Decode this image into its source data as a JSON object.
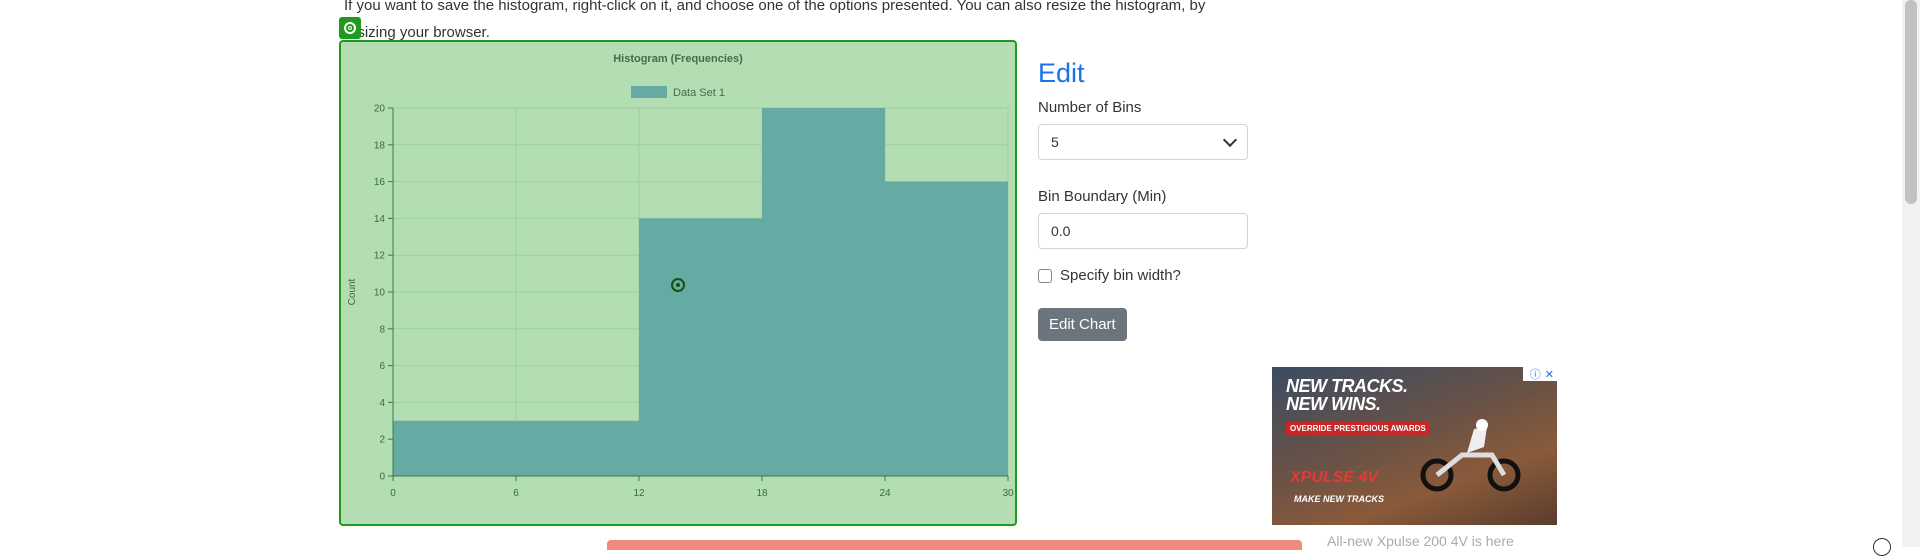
{
  "intro": {
    "line1": "If you want to save the histogram, right-click on it, and choose one of the options presented. You can also resize the histogram, by",
    "line2": "resizing your browser."
  },
  "chart_data": {
    "type": "bar",
    "title": "Histogram (Frequencies)",
    "xlabel": "",
    "ylabel": "Count",
    "bin_edges": [
      0,
      6,
      12,
      18,
      24,
      30
    ],
    "x_ticks": [
      "0",
      "6",
      "12",
      "18",
      "24",
      "30"
    ],
    "y_ticks": [
      "0",
      "2",
      "4",
      "6",
      "8",
      "10",
      "12",
      "14",
      "16",
      "18",
      "20"
    ],
    "series": [
      {
        "name": "Data Set 1",
        "values": [
          3,
          3,
          14,
          20,
          16
        ]
      }
    ],
    "xlim": [
      0,
      30
    ],
    "ylim": [
      0,
      20
    ],
    "legend": "top",
    "grid": true,
    "colors": {
      "bar": "#66aaa4",
      "background": "#b3ddb3",
      "grid": "#9fcf9f",
      "axis": "#3d7a3d"
    }
  },
  "edit": {
    "title": "Edit",
    "bins_label": "Number of Bins",
    "bins_value": "5",
    "boundary_label": "Bin Boundary (Min)",
    "boundary_value": "0.0",
    "bin_width_label": "Specify bin width?",
    "edit_button": "Edit Chart"
  },
  "ad": {
    "headline1": "NEW TRACKS.",
    "headline2": "NEW WINS.",
    "tag": "OVERRIDE PRESTIGIOUS AWARDS",
    "brand_a": "XPULSE",
    "brand_b": "4V",
    "footer": "MAKE NEW TRACKS",
    "info": "ⓘ",
    "close": "✕",
    "bottom_text": "All-new Xpulse 200 4V is here"
  }
}
